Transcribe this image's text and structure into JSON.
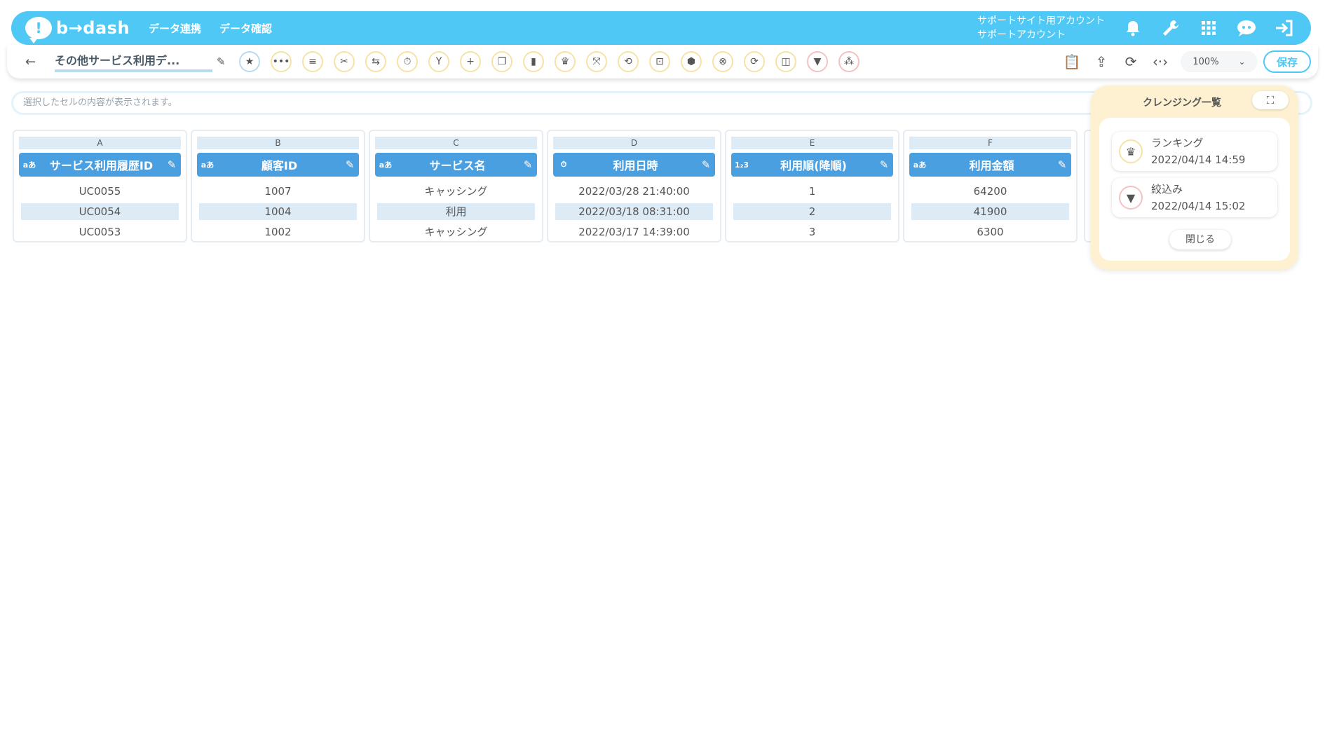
{
  "header": {
    "logo_mark": "!",
    "logo_text": "b→dash",
    "nav": [
      "データ連携",
      "データ確認"
    ],
    "account_line1": "サポートサイト用アカウント",
    "account_line2": "サポートアカウント",
    "icons": [
      "bell-icon",
      "wrench-icon",
      "grid-icon",
      "mascot-icon",
      "logout-icon"
    ]
  },
  "toolbar": {
    "back": "←",
    "title": "その他サービス利用デ...",
    "edit": "✎",
    "tools": [
      {
        "name": "star-icon",
        "glyph": "★",
        "tone": "blue"
      },
      {
        "name": "dots-icon",
        "glyph": "•••",
        "tone": "yellow"
      },
      {
        "name": "list-icon",
        "glyph": "≡",
        "tone": "yellow"
      },
      {
        "name": "scissors-icon",
        "glyph": "✂",
        "tone": "yellow"
      },
      {
        "name": "merge-icon",
        "glyph": "⇆",
        "tone": "yellow"
      },
      {
        "name": "timer-icon",
        "glyph": "⏱",
        "tone": "yellow"
      },
      {
        "name": "branch-icon",
        "glyph": "Y",
        "tone": "yellow"
      },
      {
        "name": "plus-icon",
        "glyph": "+",
        "tone": "yellow"
      },
      {
        "name": "copy-icon",
        "glyph": "❐",
        "tone": "yellow"
      },
      {
        "name": "trash-icon",
        "glyph": "▮",
        "tone": "yellow"
      },
      {
        "name": "crown-icon",
        "glyph": "♛",
        "tone": "yellow"
      },
      {
        "name": "collapse-icon",
        "glyph": "⤧",
        "tone": "yellow"
      },
      {
        "name": "repeat-icon",
        "glyph": "⟲",
        "tone": "yellow"
      },
      {
        "name": "lock-icon",
        "glyph": "⊡",
        "tone": "yellow"
      },
      {
        "name": "box-icon",
        "glyph": "⬢",
        "tone": "yellow"
      },
      {
        "name": "cancel-icon",
        "glyph": "⊗",
        "tone": "yellow"
      },
      {
        "name": "convert-icon",
        "glyph": "⟳",
        "tone": "yellow"
      },
      {
        "name": "frame-icon",
        "glyph": "◫",
        "tone": "yellow"
      },
      {
        "name": "filter-icon",
        "glyph": "▼",
        "tone": "red"
      },
      {
        "name": "dedupe-icon",
        "glyph": "⁂",
        "tone": "red"
      }
    ],
    "right_tools": [
      {
        "name": "clipboard-icon",
        "glyph": "📋"
      },
      {
        "name": "share-icon",
        "glyph": "⇪"
      },
      {
        "name": "refresh-doc-icon",
        "glyph": "⟳"
      },
      {
        "name": "code-icon",
        "glyph": "‹·›"
      }
    ],
    "zoom": "100%",
    "zoom_chevron": "⌄",
    "save_label": "保存"
  },
  "cellbar": {
    "placeholder": "選択したセルの内容が表示されます。"
  },
  "columns": [
    {
      "letter": "A",
      "type": "aあ",
      "label": "サービス利用履歴ID",
      "edit": "✎",
      "cells": [
        "UC0055",
        "UC0054",
        "UC0053"
      ]
    },
    {
      "letter": "B",
      "type": "aあ",
      "label": "顧客ID",
      "edit": "✎",
      "cells": [
        "1007",
        "1004",
        "1002"
      ]
    },
    {
      "letter": "C",
      "type": "aあ",
      "label": "サービス名",
      "edit": "✎",
      "cells": [
        "キャッシング",
        "利用",
        "キャッシング"
      ]
    },
    {
      "letter": "D",
      "type": "⏱",
      "label": "利用日時",
      "edit": "✎",
      "cells": [
        "2022/03/28 21:40:00",
        "2022/03/18 08:31:00",
        "2022/03/17 14:39:00"
      ]
    },
    {
      "letter": "E",
      "type": "1₂3",
      "label": "利用順(降順)",
      "edit": "✎",
      "cells": [
        "1",
        "2",
        "3"
      ]
    },
    {
      "letter": "F",
      "type": "aあ",
      "label": "利用金額",
      "edit": "✎",
      "cells": [
        "64200",
        "41900",
        "6300"
      ]
    }
  ],
  "panel": {
    "title": "クレンジング一覧",
    "expand": "⛶",
    "history": [
      {
        "icon_glyph": "♛",
        "name": "ランキング",
        "time": "2022/04/14 14:59"
      },
      {
        "icon_glyph": "▼",
        "name": "絞込み",
        "time": "2022/04/14 15:02"
      }
    ],
    "close_label": "閉じる"
  },
  "colors": {
    "brand": "#4fc8f5",
    "header_blue": "#4a9fe0",
    "panel_bg": "#fdf1d2",
    "stripe": "#dcebf6"
  }
}
